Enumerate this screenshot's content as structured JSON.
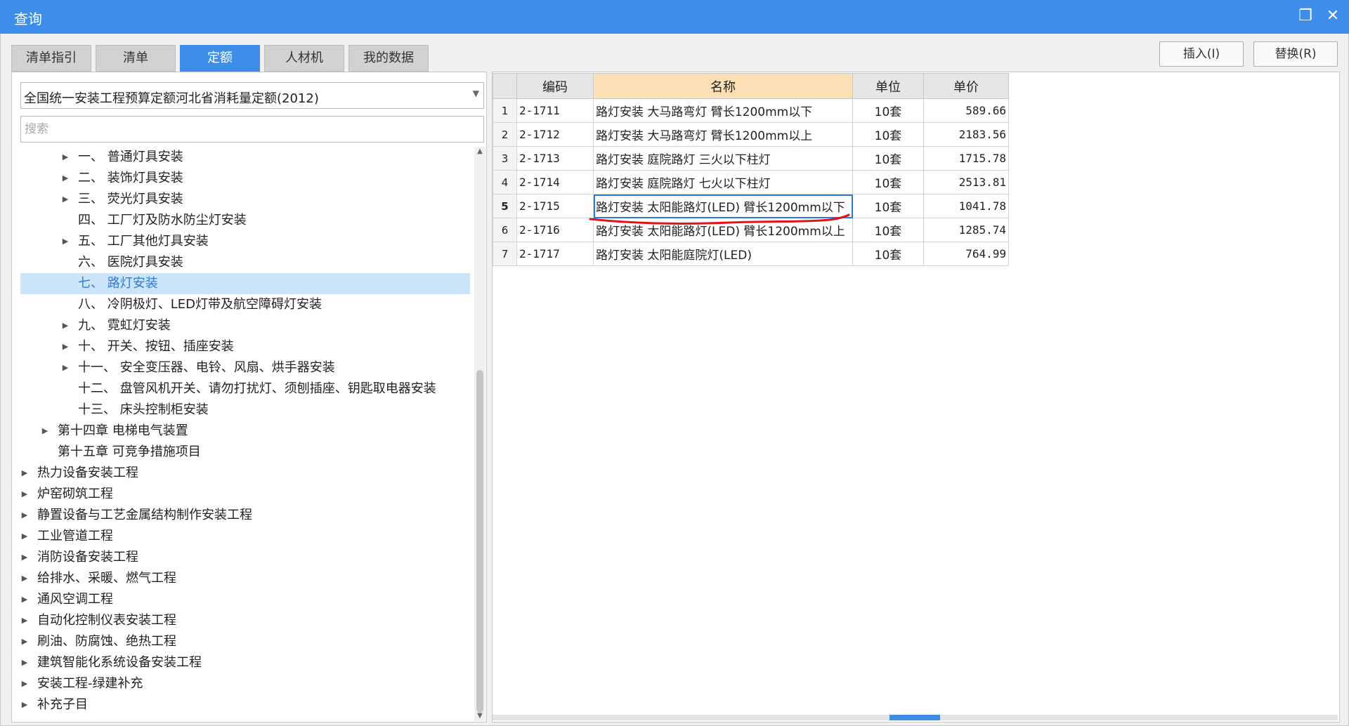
{
  "window": {
    "title": "查询",
    "restore_icon": "restore-icon",
    "close_icon": "close-icon"
  },
  "tabs": [
    {
      "label": "清单指引",
      "active": false
    },
    {
      "label": "清单",
      "active": false
    },
    {
      "label": "定额",
      "active": true
    },
    {
      "label": "人材机",
      "active": false
    },
    {
      "label": "我的数据",
      "active": false
    }
  ],
  "actions": {
    "insert_label": "插入(I)",
    "replace_label": "替换(R)"
  },
  "left": {
    "quota_library": "全国统一安装工程预算定额河北省消耗量定额(2012)",
    "search_placeholder": "搜索"
  },
  "tree": [
    {
      "label": "一、 普通灯具安装",
      "level": 3,
      "expandable": true,
      "selected": false
    },
    {
      "label": "二、 装饰灯具安装",
      "level": 3,
      "expandable": true,
      "selected": false
    },
    {
      "label": "三、 荧光灯具安装",
      "level": 3,
      "expandable": true,
      "selected": false
    },
    {
      "label": "四、 工厂灯及防水防尘灯安装",
      "level": 3,
      "expandable": false,
      "selected": false
    },
    {
      "label": "五、 工厂其他灯具安装",
      "level": 3,
      "expandable": true,
      "selected": false
    },
    {
      "label": "六、 医院灯具安装",
      "level": 3,
      "expandable": false,
      "selected": false
    },
    {
      "label": "七、 路灯安装",
      "level": 3,
      "expandable": false,
      "selected": true
    },
    {
      "label": "八、 冷阴极灯、LED灯带及航空障碍灯安装",
      "level": 3,
      "expandable": false,
      "selected": false
    },
    {
      "label": "九、 霓虹灯安装",
      "level": 3,
      "expandable": true,
      "selected": false
    },
    {
      "label": "十、 开关、按钮、插座安装",
      "level": 3,
      "expandable": true,
      "selected": false
    },
    {
      "label": "十一、 安全变压器、电铃、风扇、烘手器安装",
      "level": 3,
      "expandable": true,
      "selected": false
    },
    {
      "label": "十二、 盘管风机开关、请勿打扰灯、须刨插座、钥匙取电器安装",
      "level": 3,
      "expandable": false,
      "selected": false
    },
    {
      "label": "十三、 床头控制柜安装",
      "level": 3,
      "expandable": false,
      "selected": false
    },
    {
      "label": "第十四章 电梯电气装置",
      "level": 2,
      "expandable": true,
      "selected": false
    },
    {
      "label": "第十五章 可竞争措施项目",
      "level": 2,
      "expandable": false,
      "selected": false
    },
    {
      "label": "热力设备安装工程",
      "level": 1,
      "expandable": true,
      "selected": false
    },
    {
      "label": "炉窑砌筑工程",
      "level": 1,
      "expandable": true,
      "selected": false
    },
    {
      "label": "静置设备与工艺金属结构制作安装工程",
      "level": 1,
      "expandable": true,
      "selected": false
    },
    {
      "label": "工业管道工程",
      "level": 1,
      "expandable": true,
      "selected": false
    },
    {
      "label": "消防设备安装工程",
      "level": 1,
      "expandable": true,
      "selected": false
    },
    {
      "label": "给排水、采暖、燃气工程",
      "level": 1,
      "expandable": true,
      "selected": false
    },
    {
      "label": "通风空调工程",
      "level": 1,
      "expandable": true,
      "selected": false
    },
    {
      "label": "自动化控制仪表安装工程",
      "level": 1,
      "expandable": true,
      "selected": false
    },
    {
      "label": "刷油、防腐蚀、绝热工程",
      "level": 1,
      "expandable": true,
      "selected": false
    },
    {
      "label": "建筑智能化系统设备安装工程",
      "level": 1,
      "expandable": true,
      "selected": false
    },
    {
      "label": "安装工程-绿建补充",
      "level": 1,
      "expandable": true,
      "selected": false
    },
    {
      "label": "补充子目",
      "level": 1,
      "expandable": true,
      "selected": false
    }
  ],
  "grid": {
    "columns": [
      "编码",
      "名称",
      "单位",
      "单价"
    ],
    "rows": [
      {
        "num": "1",
        "code": "2-1711",
        "name": "路灯安装 大马路弯灯 臂长1200mm以下",
        "unit": "10套",
        "price": "589.66"
      },
      {
        "num": "2",
        "code": "2-1712",
        "name": "路灯安装 大马路弯灯 臂长1200mm以上",
        "unit": "10套",
        "price": "2183.56"
      },
      {
        "num": "3",
        "code": "2-1713",
        "name": "路灯安装 庭院路灯 三火以下柱灯",
        "unit": "10套",
        "price": "1715.78"
      },
      {
        "num": "4",
        "code": "2-1714",
        "name": "路灯安装 庭院路灯 七火以下柱灯",
        "unit": "10套",
        "price": "2513.81"
      },
      {
        "num": "5",
        "code": "2-1715",
        "name": "路灯安装 太阳能路灯(LED) 臂长1200mm以下",
        "unit": "10套",
        "price": "1041.78"
      },
      {
        "num": "6",
        "code": "2-1716",
        "name": "路灯安装 太阳能路灯(LED) 臂长1200mm以上",
        "unit": "10套",
        "price": "1285.74"
      },
      {
        "num": "7",
        "code": "2-1717",
        "name": "路灯安装 太阳能庭院灯(LED)",
        "unit": "10套",
        "price": "764.99"
      }
    ],
    "selected_row": 5,
    "annotation_color": "#e0141e"
  }
}
